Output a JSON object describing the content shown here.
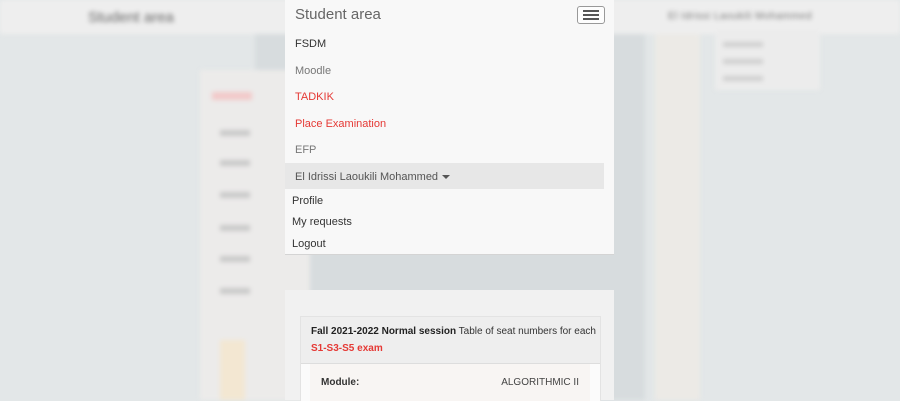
{
  "navbar": {
    "brand": "Student area",
    "items": [
      {
        "label": "FSDM"
      },
      {
        "label": "Moodle"
      },
      {
        "label": "TADKIK"
      },
      {
        "label": "Place Examination"
      },
      {
        "label": "EFP"
      }
    ],
    "user": {
      "name": "El Idrissi Laoukili Mohammed",
      "menu": [
        {
          "label": "Profile"
        },
        {
          "label": "My requests"
        },
        {
          "label": "Logout"
        }
      ]
    }
  },
  "card": {
    "session_bold": "Fall 2021-2022 Normal session",
    "session_rest": " Table of seat numbers for each",
    "exam_label": "S1-S3-S5 exam",
    "module_label": "Module:",
    "module_value": "ALGORITHMIC II"
  },
  "colors": {
    "accent_red": "#e53935",
    "navbar_bg": "#f8f8f8",
    "page_bg": "#e3e7e8"
  },
  "icons": {
    "menu_toggle": "hamburger-icon",
    "user_dropdown": "caret-down-icon"
  }
}
